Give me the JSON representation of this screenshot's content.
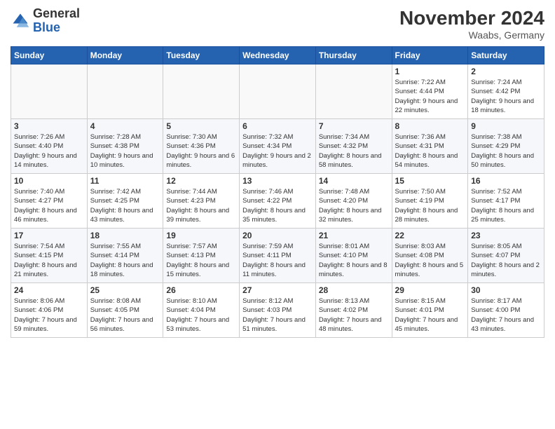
{
  "header": {
    "logo_general": "General",
    "logo_blue": "Blue",
    "month_title": "November 2024",
    "location": "Waabs, Germany"
  },
  "days_of_week": [
    "Sunday",
    "Monday",
    "Tuesday",
    "Wednesday",
    "Thursday",
    "Friday",
    "Saturday"
  ],
  "weeks": [
    [
      {
        "day": "",
        "info": ""
      },
      {
        "day": "",
        "info": ""
      },
      {
        "day": "",
        "info": ""
      },
      {
        "day": "",
        "info": ""
      },
      {
        "day": "",
        "info": ""
      },
      {
        "day": "1",
        "info": "Sunrise: 7:22 AM\nSunset: 4:44 PM\nDaylight: 9 hours and 22 minutes."
      },
      {
        "day": "2",
        "info": "Sunrise: 7:24 AM\nSunset: 4:42 PM\nDaylight: 9 hours and 18 minutes."
      }
    ],
    [
      {
        "day": "3",
        "info": "Sunrise: 7:26 AM\nSunset: 4:40 PM\nDaylight: 9 hours and 14 minutes."
      },
      {
        "day": "4",
        "info": "Sunrise: 7:28 AM\nSunset: 4:38 PM\nDaylight: 9 hours and 10 minutes."
      },
      {
        "day": "5",
        "info": "Sunrise: 7:30 AM\nSunset: 4:36 PM\nDaylight: 9 hours and 6 minutes."
      },
      {
        "day": "6",
        "info": "Sunrise: 7:32 AM\nSunset: 4:34 PM\nDaylight: 9 hours and 2 minutes."
      },
      {
        "day": "7",
        "info": "Sunrise: 7:34 AM\nSunset: 4:32 PM\nDaylight: 8 hours and 58 minutes."
      },
      {
        "day": "8",
        "info": "Sunrise: 7:36 AM\nSunset: 4:31 PM\nDaylight: 8 hours and 54 minutes."
      },
      {
        "day": "9",
        "info": "Sunrise: 7:38 AM\nSunset: 4:29 PM\nDaylight: 8 hours and 50 minutes."
      }
    ],
    [
      {
        "day": "10",
        "info": "Sunrise: 7:40 AM\nSunset: 4:27 PM\nDaylight: 8 hours and 46 minutes."
      },
      {
        "day": "11",
        "info": "Sunrise: 7:42 AM\nSunset: 4:25 PM\nDaylight: 8 hours and 43 minutes."
      },
      {
        "day": "12",
        "info": "Sunrise: 7:44 AM\nSunset: 4:23 PM\nDaylight: 8 hours and 39 minutes."
      },
      {
        "day": "13",
        "info": "Sunrise: 7:46 AM\nSunset: 4:22 PM\nDaylight: 8 hours and 35 minutes."
      },
      {
        "day": "14",
        "info": "Sunrise: 7:48 AM\nSunset: 4:20 PM\nDaylight: 8 hours and 32 minutes."
      },
      {
        "day": "15",
        "info": "Sunrise: 7:50 AM\nSunset: 4:19 PM\nDaylight: 8 hours and 28 minutes."
      },
      {
        "day": "16",
        "info": "Sunrise: 7:52 AM\nSunset: 4:17 PM\nDaylight: 8 hours and 25 minutes."
      }
    ],
    [
      {
        "day": "17",
        "info": "Sunrise: 7:54 AM\nSunset: 4:15 PM\nDaylight: 8 hours and 21 minutes."
      },
      {
        "day": "18",
        "info": "Sunrise: 7:55 AM\nSunset: 4:14 PM\nDaylight: 8 hours and 18 minutes."
      },
      {
        "day": "19",
        "info": "Sunrise: 7:57 AM\nSunset: 4:13 PM\nDaylight: 8 hours and 15 minutes."
      },
      {
        "day": "20",
        "info": "Sunrise: 7:59 AM\nSunset: 4:11 PM\nDaylight: 8 hours and 11 minutes."
      },
      {
        "day": "21",
        "info": "Sunrise: 8:01 AM\nSunset: 4:10 PM\nDaylight: 8 hours and 8 minutes."
      },
      {
        "day": "22",
        "info": "Sunrise: 8:03 AM\nSunset: 4:08 PM\nDaylight: 8 hours and 5 minutes."
      },
      {
        "day": "23",
        "info": "Sunrise: 8:05 AM\nSunset: 4:07 PM\nDaylight: 8 hours and 2 minutes."
      }
    ],
    [
      {
        "day": "24",
        "info": "Sunrise: 8:06 AM\nSunset: 4:06 PM\nDaylight: 7 hours and 59 minutes."
      },
      {
        "day": "25",
        "info": "Sunrise: 8:08 AM\nSunset: 4:05 PM\nDaylight: 7 hours and 56 minutes."
      },
      {
        "day": "26",
        "info": "Sunrise: 8:10 AM\nSunset: 4:04 PM\nDaylight: 7 hours and 53 minutes."
      },
      {
        "day": "27",
        "info": "Sunrise: 8:12 AM\nSunset: 4:03 PM\nDaylight: 7 hours and 51 minutes."
      },
      {
        "day": "28",
        "info": "Sunrise: 8:13 AM\nSunset: 4:02 PM\nDaylight: 7 hours and 48 minutes."
      },
      {
        "day": "29",
        "info": "Sunrise: 8:15 AM\nSunset: 4:01 PM\nDaylight: 7 hours and 45 minutes."
      },
      {
        "day": "30",
        "info": "Sunrise: 8:17 AM\nSunset: 4:00 PM\nDaylight: 7 hours and 43 minutes."
      }
    ]
  ]
}
